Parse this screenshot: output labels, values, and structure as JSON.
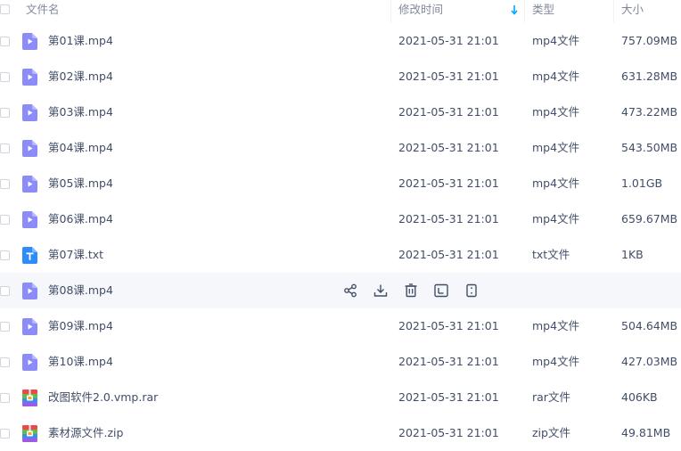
{
  "header": {
    "name": "文件名",
    "mtime": "修改时间",
    "type": "类型",
    "size": "大小"
  },
  "colors": {
    "video_icon": "#8b8cf7",
    "txt_icon": "#2c8cf8",
    "accent": "#06a7ff"
  },
  "files": [
    {
      "name": "第01课.mp4",
      "mtime": "2021-05-31 21:01",
      "type": "mp4文件",
      "size": "757.09MB",
      "icon": "video-file-icon"
    },
    {
      "name": "第02课.mp4",
      "mtime": "2021-05-31 21:01",
      "type": "mp4文件",
      "size": "631.28MB",
      "icon": "video-file-icon"
    },
    {
      "name": "第03课.mp4",
      "mtime": "2021-05-31 21:01",
      "type": "mp4文件",
      "size": "473.22MB",
      "icon": "video-file-icon"
    },
    {
      "name": "第04课.mp4",
      "mtime": "2021-05-31 21:01",
      "type": "mp4文件",
      "size": "543.50MB",
      "icon": "video-file-icon"
    },
    {
      "name": "第05课.mp4",
      "mtime": "2021-05-31 21:01",
      "type": "mp4文件",
      "size": "1.01GB",
      "icon": "video-file-icon"
    },
    {
      "name": "第06课.mp4",
      "mtime": "2021-05-31 21:01",
      "type": "mp4文件",
      "size": "659.67MB",
      "icon": "video-file-icon"
    },
    {
      "name": "第07课.txt",
      "mtime": "2021-05-31 21:01",
      "type": "txt文件",
      "size": "1KB",
      "icon": "text-file-icon"
    },
    {
      "name": "第08课.mp4",
      "icon": "video-file-icon"
    },
    {
      "name": "第09课.mp4",
      "mtime": "2021-05-31 21:01",
      "type": "mp4文件",
      "size": "504.64MB",
      "icon": "video-file-icon"
    },
    {
      "name": "第10课.mp4",
      "mtime": "2021-05-31 21:01",
      "type": "mp4文件",
      "size": "427.03MB",
      "icon": "video-file-icon"
    },
    {
      "name": "改图软件2.0.vmp.rar",
      "mtime": "2021-05-31 21:01",
      "type": "rar文件",
      "size": "406KB",
      "icon": "archive-file-icon"
    },
    {
      "name": "素材源文件.zip",
      "mtime": "2021-05-31 21:01",
      "type": "zip文件",
      "size": "49.81MB",
      "icon": "archive-file-icon"
    }
  ],
  "hover_actions": [
    "share-icon",
    "download-icon",
    "delete-icon",
    "rename-icon",
    "more-icon"
  ]
}
